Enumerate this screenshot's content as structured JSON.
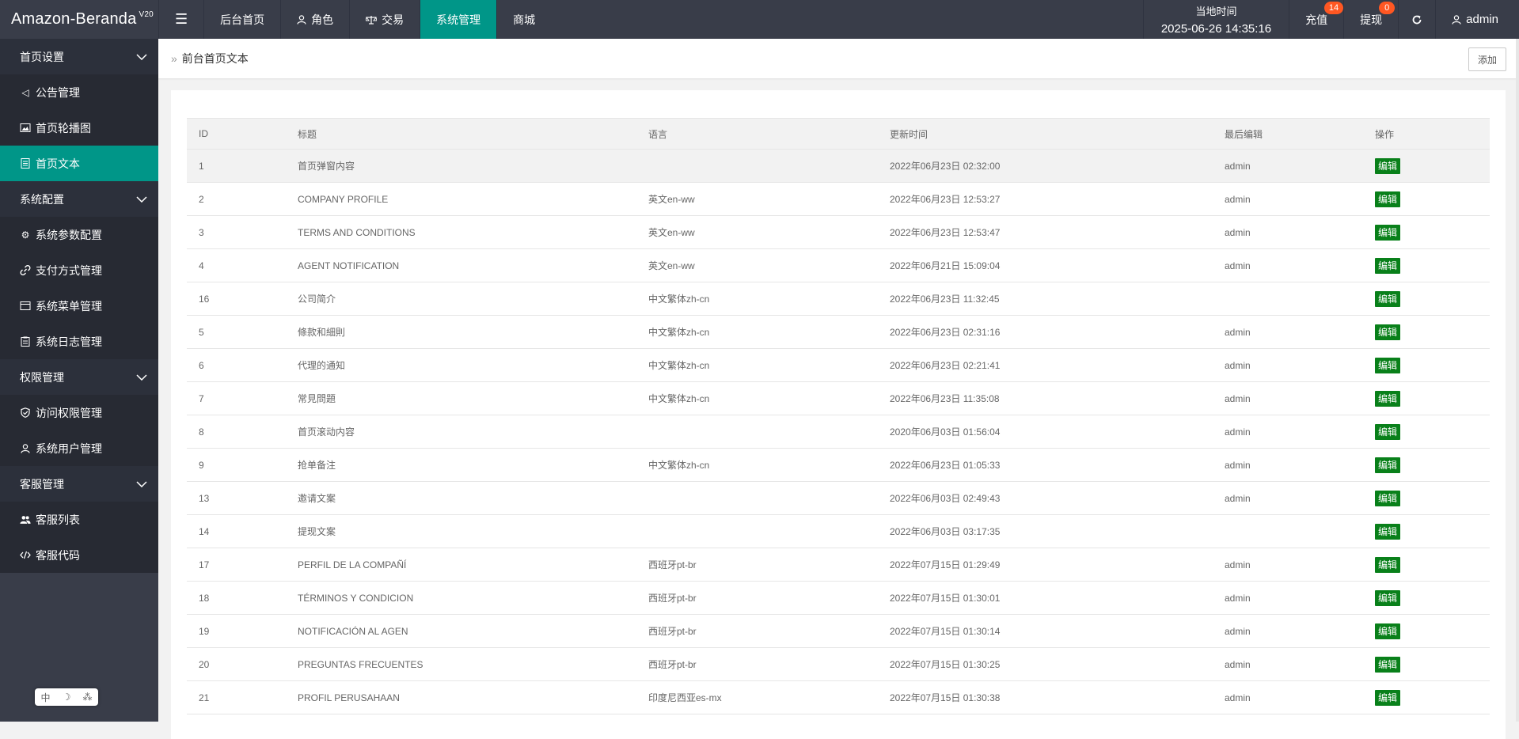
{
  "brand": {
    "name": "Amazon-Beranda",
    "version": "V20"
  },
  "topnav": {
    "toggle_icon": "menu-fold-icon",
    "items": [
      {
        "label": "后台首页",
        "icon": ""
      },
      {
        "label": "角色",
        "icon": "user-icon"
      },
      {
        "label": "交易",
        "icon": "scale-icon"
      },
      {
        "label": "系统管理",
        "icon": "",
        "active": true
      },
      {
        "label": "商城",
        "icon": ""
      }
    ],
    "time_label": "当地时间",
    "time_value": "2025-06-26 14:35:16",
    "recharge_label": "充值",
    "recharge_badge": "14",
    "withdraw_label": "提现",
    "withdraw_badge": "0",
    "refresh_icon": "refresh-icon",
    "user_label": "admin"
  },
  "sidebar": {
    "groups": [
      {
        "label": "首页设置",
        "items": [
          {
            "label": "公告管理",
            "icon": "speaker-icon"
          },
          {
            "label": "首页轮播图",
            "icon": "image-icon"
          },
          {
            "label": "首页文本",
            "icon": "document-icon",
            "active": true
          }
        ]
      },
      {
        "label": "系统配置",
        "items": [
          {
            "label": "系统参数配置",
            "icon": "gear-icon"
          },
          {
            "label": "支付方式管理",
            "icon": "link-icon"
          },
          {
            "label": "系统菜单管理",
            "icon": "window-icon"
          },
          {
            "label": "系统日志管理",
            "icon": "log-icon"
          }
        ]
      },
      {
        "label": "权限管理",
        "items": [
          {
            "label": "访问权限管理",
            "icon": "shield-icon"
          },
          {
            "label": "系统用户管理",
            "icon": "user-icon"
          }
        ]
      },
      {
        "label": "客服管理",
        "items": [
          {
            "label": "客服列表",
            "icon": "users-icon"
          },
          {
            "label": "客服代码",
            "icon": "code-icon"
          }
        ]
      }
    ],
    "ime": {
      "a": "中",
      "b": "☽",
      "c": "⁂"
    }
  },
  "breadcrumb": {
    "label": "前台首页文本"
  },
  "add_button": "添加",
  "table": {
    "headers": [
      "ID",
      "标题",
      "语言",
      "更新时间",
      "最后编辑",
      "操作"
    ],
    "edit_label": "编辑",
    "rows": [
      {
        "id": "1",
        "title": "首页弹窗内容",
        "lang": "",
        "time": "2022年06月23日 02:32:00",
        "editor": "admin"
      },
      {
        "id": "2",
        "title": "COMPANY PROFILE",
        "lang": "英文en-ww",
        "time": "2022年06月23日 12:53:27",
        "editor": "admin"
      },
      {
        "id": "3",
        "title": "TERMS AND CONDITIONS",
        "lang": "英文en-ww",
        "time": "2022年06月23日 12:53:47",
        "editor": "admin"
      },
      {
        "id": "4",
        "title": "AGENT NOTIFICATION",
        "lang": "英文en-ww",
        "time": "2022年06月21日 15:09:04",
        "editor": "admin"
      },
      {
        "id": "16",
        "title": "公司简介",
        "lang": "中文繁体zh-cn",
        "time": "2022年06月23日 11:32:45",
        "editor": ""
      },
      {
        "id": "5",
        "title": "條款和細則",
        "lang": "中文繁体zh-cn",
        "time": "2022年06月23日 02:31:16",
        "editor": "admin"
      },
      {
        "id": "6",
        "title": "代理的通知",
        "lang": "中文繁体zh-cn",
        "time": "2022年06月23日 02:21:41",
        "editor": "admin"
      },
      {
        "id": "7",
        "title": "常見問題",
        "lang": "中文繁体zh-cn",
        "time": "2022年06月23日 11:35:08",
        "editor": "admin"
      },
      {
        "id": "8",
        "title": "首页滚动内容",
        "lang": "",
        "time": "2020年06月03日 01:56:04",
        "editor": "admin"
      },
      {
        "id": "9",
        "title": "抢单备注",
        "lang": "中文繁体zh-cn",
        "time": "2022年06月23日 01:05:33",
        "editor": "admin"
      },
      {
        "id": "13",
        "title": "邀请文案",
        "lang": "",
        "time": "2022年06月03日 02:49:43",
        "editor": "admin"
      },
      {
        "id": "14",
        "title": "提现文案",
        "lang": "",
        "time": "2022年06月03日 03:17:35",
        "editor": ""
      },
      {
        "id": "17",
        "title": "PERFIL DE LA COMPAÑÍ",
        "lang": "西班牙pt-br",
        "time": "2022年07月15日 01:29:49",
        "editor": "admin"
      },
      {
        "id": "18",
        "title": "TÉRMINOS Y CONDICION",
        "lang": "西班牙pt-br",
        "time": "2022年07月15日 01:30:01",
        "editor": "admin"
      },
      {
        "id": "19",
        "title": "NOTIFICACIÓN AL AGEN",
        "lang": "西班牙pt-br",
        "time": "2022年07月15日 01:30:14",
        "editor": "admin"
      },
      {
        "id": "20",
        "title": "PREGUNTAS FRECUENTES",
        "lang": "西班牙pt-br",
        "time": "2022年07月15日 01:30:25",
        "editor": "admin"
      },
      {
        "id": "21",
        "title": "PROFIL PERUSAHAAN",
        "lang": "印度尼西亚es-mx",
        "time": "2022年07月15日 01:30:38",
        "editor": "admin"
      }
    ]
  }
}
